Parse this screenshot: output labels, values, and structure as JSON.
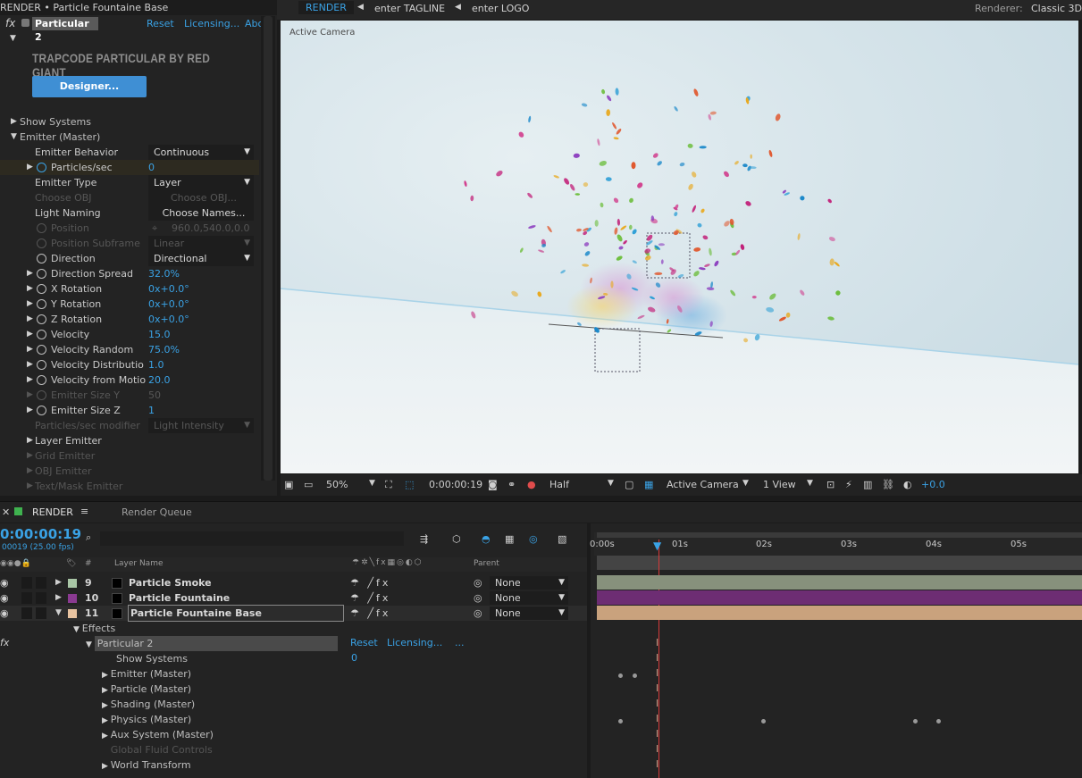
{
  "effect_controls": {
    "title": "RENDER • Particle Fountaine Base",
    "fx_badge": "fx",
    "effect_name": "Particular 2",
    "reset": "Reset",
    "licensing": "Licensing...",
    "about": "Abo",
    "brand": "TRAPCODE PARTICULAR BY RED GIANT",
    "designer_button": "Designer...",
    "rows": [
      {
        "label": "Show Systems"
      },
      {
        "label": "Emitter (Master)"
      },
      {
        "label": "Emitter Behavior",
        "value": "Continuous"
      },
      {
        "label": "Particles/sec",
        "value": "0"
      },
      {
        "label": "Emitter Type",
        "value": "Layer"
      },
      {
        "label": "Choose OBJ",
        "value": "Choose OBJ..."
      },
      {
        "label": "Light Naming",
        "value": "Choose Names..."
      },
      {
        "label": "Position",
        "value": "960.0,540.0,0.0"
      },
      {
        "label": "Position Subframe",
        "value": "Linear"
      },
      {
        "label": "Direction",
        "value": "Directional"
      },
      {
        "label": "Direction Spread",
        "value": "32.0%"
      },
      {
        "label": "X Rotation",
        "value": "0x+0.0°"
      },
      {
        "label": "Y Rotation",
        "value": "0x+0.0°"
      },
      {
        "label": "Z Rotation",
        "value": "0x+0.0°"
      },
      {
        "label": "Velocity",
        "value": "15.0"
      },
      {
        "label": "Velocity Random",
        "value": "75.0%"
      },
      {
        "label": "Velocity Distributio",
        "value": "1.0"
      },
      {
        "label": "Velocity from Motio",
        "value": "20.0"
      },
      {
        "label": "Emitter Size Y",
        "value": "50"
      },
      {
        "label": "Emitter Size Z",
        "value": "1"
      },
      {
        "label": "Particles/sec modifier",
        "value": "Light Intensity"
      },
      {
        "label": "Layer Emitter"
      },
      {
        "label": "Grid Emitter"
      },
      {
        "label": "OBJ Emitter"
      },
      {
        "label": "Text/Mask Emitter"
      }
    ]
  },
  "viewer": {
    "tabs": [
      "RENDER",
      "enter TAGLINE",
      "enter LOGO"
    ],
    "renderer_label": "Renderer:",
    "renderer_value": "Classic 3D",
    "camera_label": "Active Camera",
    "zoom": "50%",
    "timecode": "0:00:00:19",
    "resolution": "Half",
    "view_camera": "Active Camera",
    "view_layout": "1 View",
    "exposure": "+0.0"
  },
  "timeline": {
    "tabs": [
      "RENDER",
      "Render Queue"
    ],
    "current_time": "0:00:00:19",
    "frame_info": "00019 (25.00 fps)",
    "search_placeholder": "",
    "col_num": "#",
    "col_layer_name": "Layer Name",
    "col_parent": "Parent",
    "ruler_ticks": [
      "0:00s",
      "01s",
      "02s",
      "03s",
      "04s",
      "05s"
    ],
    "layers": [
      {
        "index": "9",
        "name": "Particle Smoke",
        "parent": "None",
        "label_color": "#a9c6a6",
        "bar_color": "#87917c"
      },
      {
        "index": "10",
        "name": "Particle Fountaine",
        "parent": "None",
        "label_color": "#8a3a91",
        "bar_color": "#6d2d73"
      },
      {
        "index": "11",
        "name": "Particle Fountaine Base",
        "parent": "None",
        "label_color": "#e8c3a0",
        "bar_color": "#c9a27d"
      }
    ],
    "effects_label": "Effects",
    "effect_name": "Particular 2",
    "effect_reset": "Reset",
    "effect_licensing": "Licensing...",
    "effect_more": "...",
    "effect_fx": "fx",
    "show_systems": "Show Systems",
    "show_systems_value": "0",
    "groups": [
      "Emitter (Master)",
      "Particle (Master)",
      "Shading (Master)",
      "Physics (Master)",
      "Aux System (Master)",
      "Global Fluid Controls",
      "World Transform"
    ]
  }
}
